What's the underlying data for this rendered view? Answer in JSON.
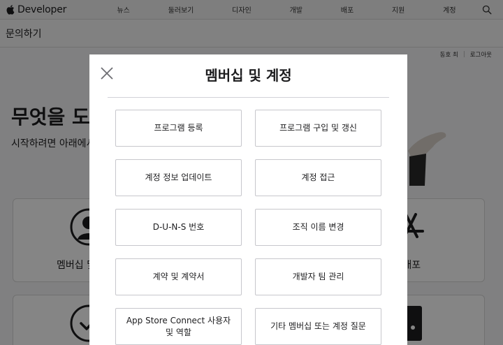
{
  "topnav": {
    "brand": "Developer",
    "links": [
      "뉴스",
      "둘러보기",
      "디자인",
      "개발",
      "배포",
      "지원",
      "계정"
    ]
  },
  "subnav": {
    "title": "문의하기"
  },
  "userbar": {
    "user": "동호 최",
    "logout": "로그아웃"
  },
  "hero": {
    "title": "무엇을 도와",
    "subtitle": "시작하려면 아래에서"
  },
  "cards": {
    "membership_label": "멤버십 및",
    "distribution_label": "및 배포"
  },
  "modal": {
    "title": "멤버십 및 계정",
    "options": [
      "프로그램 등록",
      "프로그램 구입 및 갱신",
      "계정 정보 업데이트",
      "계정 접근",
      "D-U-N-S 번호",
      "조직 이름 변경",
      "계약 및 계약서",
      "개발자 팀 관리",
      "App Store Connect 사용자 및 역할",
      "기타 멤버십 또는 계정 질문"
    ]
  },
  "colors": {
    "text": "#1d1d1f",
    "overlay": "rgba(0,0,0,0.48)",
    "border": "#c7c7cc"
  }
}
